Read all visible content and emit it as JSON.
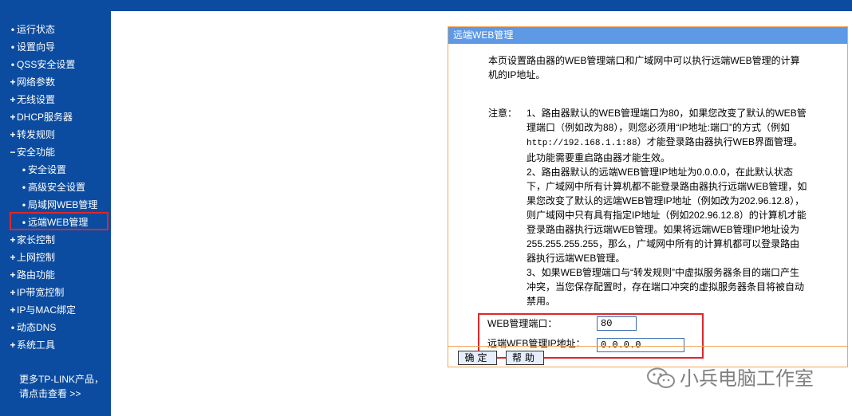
{
  "sidebar": {
    "items": [
      {
        "marker": "•",
        "label": "运行状态"
      },
      {
        "marker": "•",
        "label": "设置向导"
      },
      {
        "marker": "•",
        "label": "QSS安全设置"
      },
      {
        "marker": "+",
        "label": "网络参数"
      },
      {
        "marker": "+",
        "label": "无线设置"
      },
      {
        "marker": "+",
        "label": "DHCP服务器"
      },
      {
        "marker": "+",
        "label": "转发规则"
      },
      {
        "marker": "−",
        "label": "安全功能"
      },
      {
        "marker": "•",
        "label": "安全设置"
      },
      {
        "marker": "•",
        "label": "高级安全设置"
      },
      {
        "marker": "•",
        "label": "局域网WEB管理"
      },
      {
        "marker": "•",
        "label": "远端WEB管理"
      },
      {
        "marker": "+",
        "label": "家长控制"
      },
      {
        "marker": "+",
        "label": "上网控制"
      },
      {
        "marker": "+",
        "label": "路由功能"
      },
      {
        "marker": "+",
        "label": "IP带宽控制"
      },
      {
        "marker": "+",
        "label": "IP与MAC绑定"
      },
      {
        "marker": "•",
        "label": "动态DNS"
      },
      {
        "marker": "+",
        "label": "系统工具"
      }
    ],
    "more_line1": "更多TP-LINK产品，",
    "more_line2": "请点击查看 >>"
  },
  "panel": {
    "title": "远端WEB管理",
    "intro": "本页设置路由器的WEB管理端口和广域网中可以执行远端WEB管理的计算机的IP地址。",
    "note_label": "注意：",
    "note1_a": "1、路由器默认的WEB管理端口为80，如果您改变了默认的WEB管理端口（例如改为88），则您必须用“IP地址:端口”的方式（例如",
    "note1_url": "http://192.168.1.1:88",
    "note1_b": "）才能登录路由器执行WEB界面管理。此功能需要重启路由器才能生效。",
    "note2": "2、路由器默认的远端WEB管理IP地址为0.0.0.0，在此默认状态下，广域网中所有计算机都不能登录路由器执行远端WEB管理，如果您改变了默认的远端WEB管理IP地址（例如改为202.96.12.8），则广域网中只有具有指定IP地址（例如202.96.12.8）的计算机才能登录路由器执行远端WEB管理。如果将远端WEB管理IP地址设为255.255.255.255，那么，广域网中所有的计算机都可以登录路由器执行远端WEB管理。",
    "note3": "3、如果WEB管理端口与“转发规则”中虚拟服务器条目的端口产生冲突，当您保存配置时，存在端口冲突的虚拟服务器条目将被自动禁用。",
    "port_label": "WEB管理端口：",
    "port_value": "80",
    "ip_label": "远端WEB管理IP地址：",
    "ip_value": "0.0.0.0",
    "ok_label": "确定",
    "help_label": "帮助"
  },
  "watermark": {
    "text": "小兵电脑工作室",
    "icon": "wechat-icon"
  },
  "colors": {
    "sidebar_bg": "#0b4ca0",
    "panel_title_bg": "#5e99e6",
    "panel_border": "#f2a65a",
    "highlight": "#e0262a"
  }
}
